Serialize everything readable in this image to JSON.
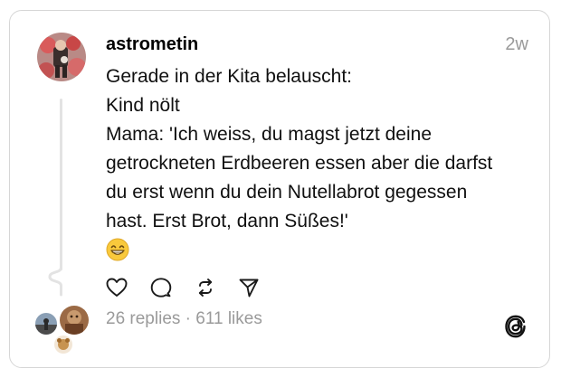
{
  "post": {
    "username": "astrometin",
    "time": "2w",
    "lines": [
      "Gerade in der Kita belauscht:",
      "Kind nölt",
      "Mama: 'Ich weiss, du magst jetzt deine",
      "getrockneten Erdbeeren essen aber die darfst",
      "du erst wenn du dein Nutellabrot gegessen",
      "hast. Erst Brot, dann Süßes!'"
    ],
    "emoji": "grinning-face-with-smiling-eyes"
  },
  "actions": [
    "heart-icon",
    "comment-icon",
    "repost-icon",
    "share-icon"
  ],
  "stats": {
    "replies": "26 replies",
    "separator": "·",
    "likes": "611 likes",
    "text": "26 replies · 611 likes"
  },
  "colors": {
    "text": "#101010",
    "muted": "#9a9a9a",
    "border": "#d6d6d6",
    "thread_line": "#e3e3e3",
    "emoji_yellow": "#f9c93c"
  }
}
